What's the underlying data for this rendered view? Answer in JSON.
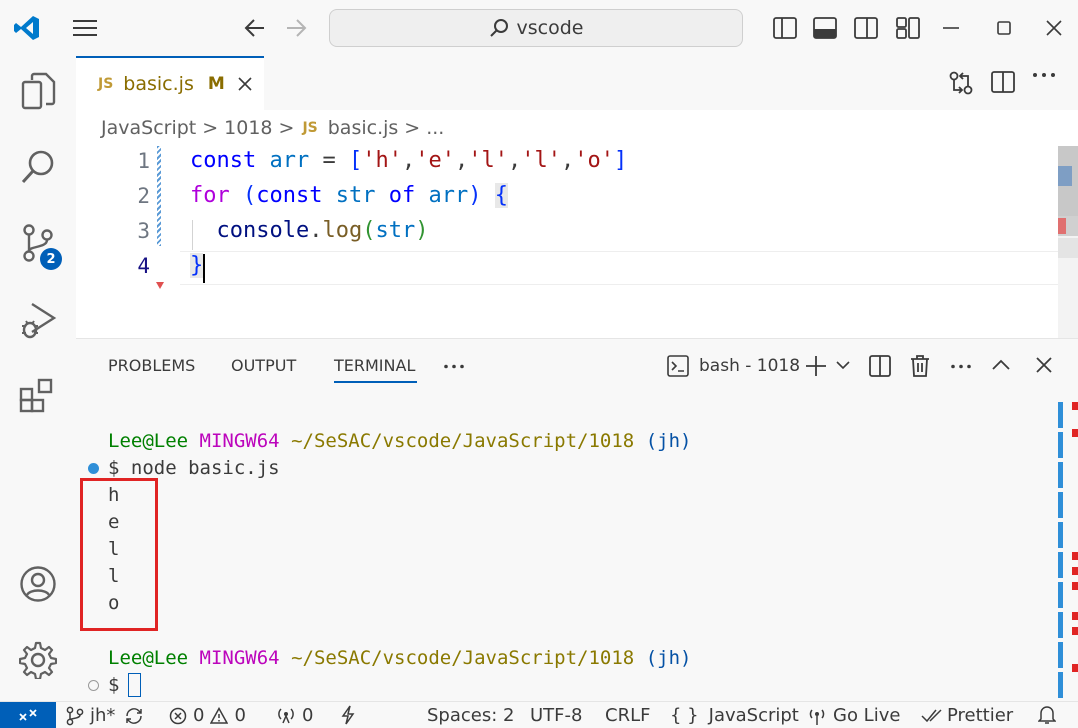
{
  "titlebar": {
    "search_text": "vscode"
  },
  "activity": {
    "source_control_badge": "2"
  },
  "tab": {
    "icon": "JS",
    "name": "basic.js",
    "status": "M"
  },
  "breadcrumb": {
    "part1": "JavaScript",
    "sep": ">",
    "part2": "1018",
    "icon": "JS",
    "part3": "basic.js",
    "ellipsis": "..."
  },
  "code": {
    "line_numbers": [
      "1",
      "2",
      "3",
      "4"
    ]
  },
  "panel": {
    "tabs": [
      "PROBLEMS",
      "OUTPUT",
      "TERMINAL"
    ],
    "more": "···",
    "terminal_name": "bash - 1018"
  },
  "terminal": {
    "user": "Lee@Lee",
    "env": "MINGW64",
    "path": "~/SeSAC/vscode/JavaScript/1018",
    "branch": "(jh)",
    "prompt": "$",
    "command": "node basic.js",
    "output": [
      "h",
      "e",
      "l",
      "l",
      "o"
    ]
  },
  "status": {
    "branch": "jh*",
    "errors": "0",
    "warnings": "0",
    "ports": "0",
    "spaces": "Spaces: 2",
    "encoding": "UTF-8",
    "eol": "CRLF",
    "braces": "{ }",
    "language": "JavaScript",
    "golive": "Go Live",
    "prettier": "Prettier"
  },
  "colors": {
    "accent": "#005fb8",
    "highlight_box": "#e02424",
    "keyword": "#0000ff",
    "string": "#a31515",
    "control": "#af00db",
    "variable": "#0070c1",
    "terminal_green": "#008000",
    "terminal_magenta": "#bc05bc",
    "terminal_yellow": "#8a7900",
    "terminal_blue": "#0451a5"
  }
}
